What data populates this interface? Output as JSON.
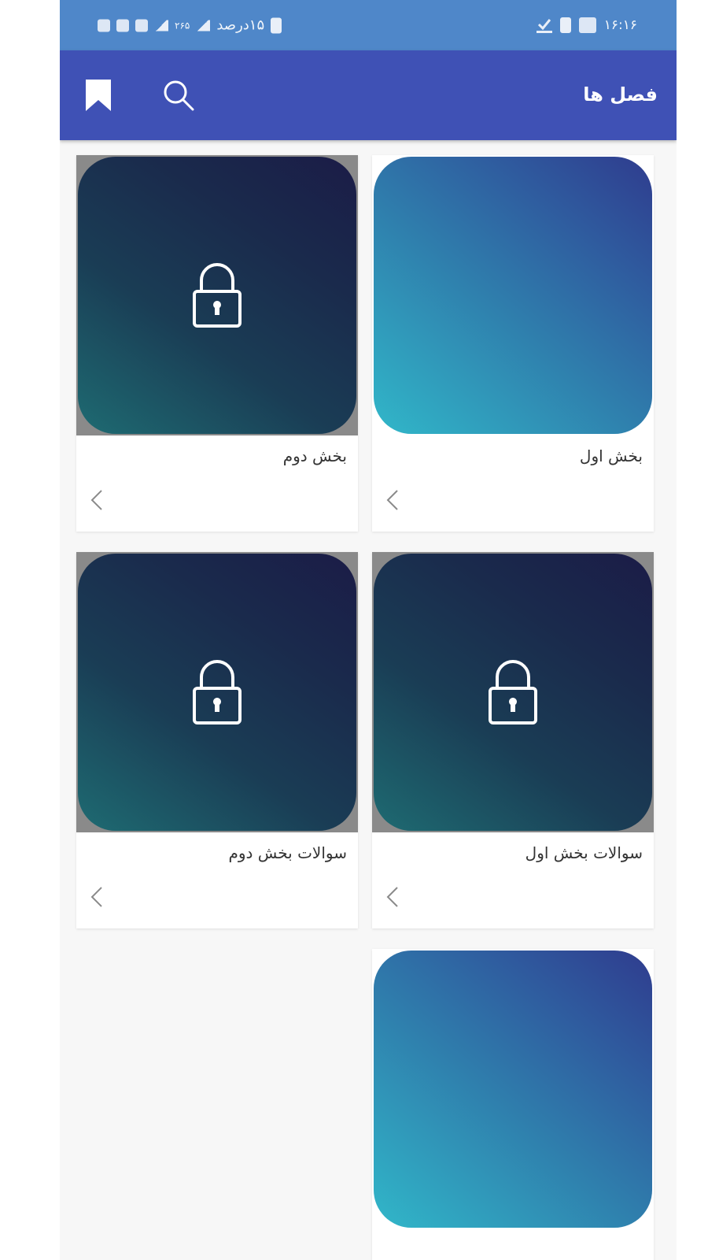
{
  "status_bar": {
    "time": "۱۶:۱۶",
    "battery_text": "۱۵درصد",
    "network_speed": "۲۶۵"
  },
  "app_bar": {
    "title": "فصل ها",
    "icons": [
      "bookmark-icon",
      "search-icon"
    ]
  },
  "chapters": [
    {
      "title": "بخش اول",
      "locked": false
    },
    {
      "title": "بخش دوم",
      "locked": true
    },
    {
      "title": "سوالات بخش اول",
      "locked": true
    },
    {
      "title": "سوالات بخش دوم",
      "locked": true
    },
    {
      "title": "",
      "locked": false
    }
  ],
  "colors": {
    "status_bar": "#4f87c9",
    "app_bar": "#3f51b5",
    "background": "#f7f7f7",
    "card": "#ffffff"
  }
}
